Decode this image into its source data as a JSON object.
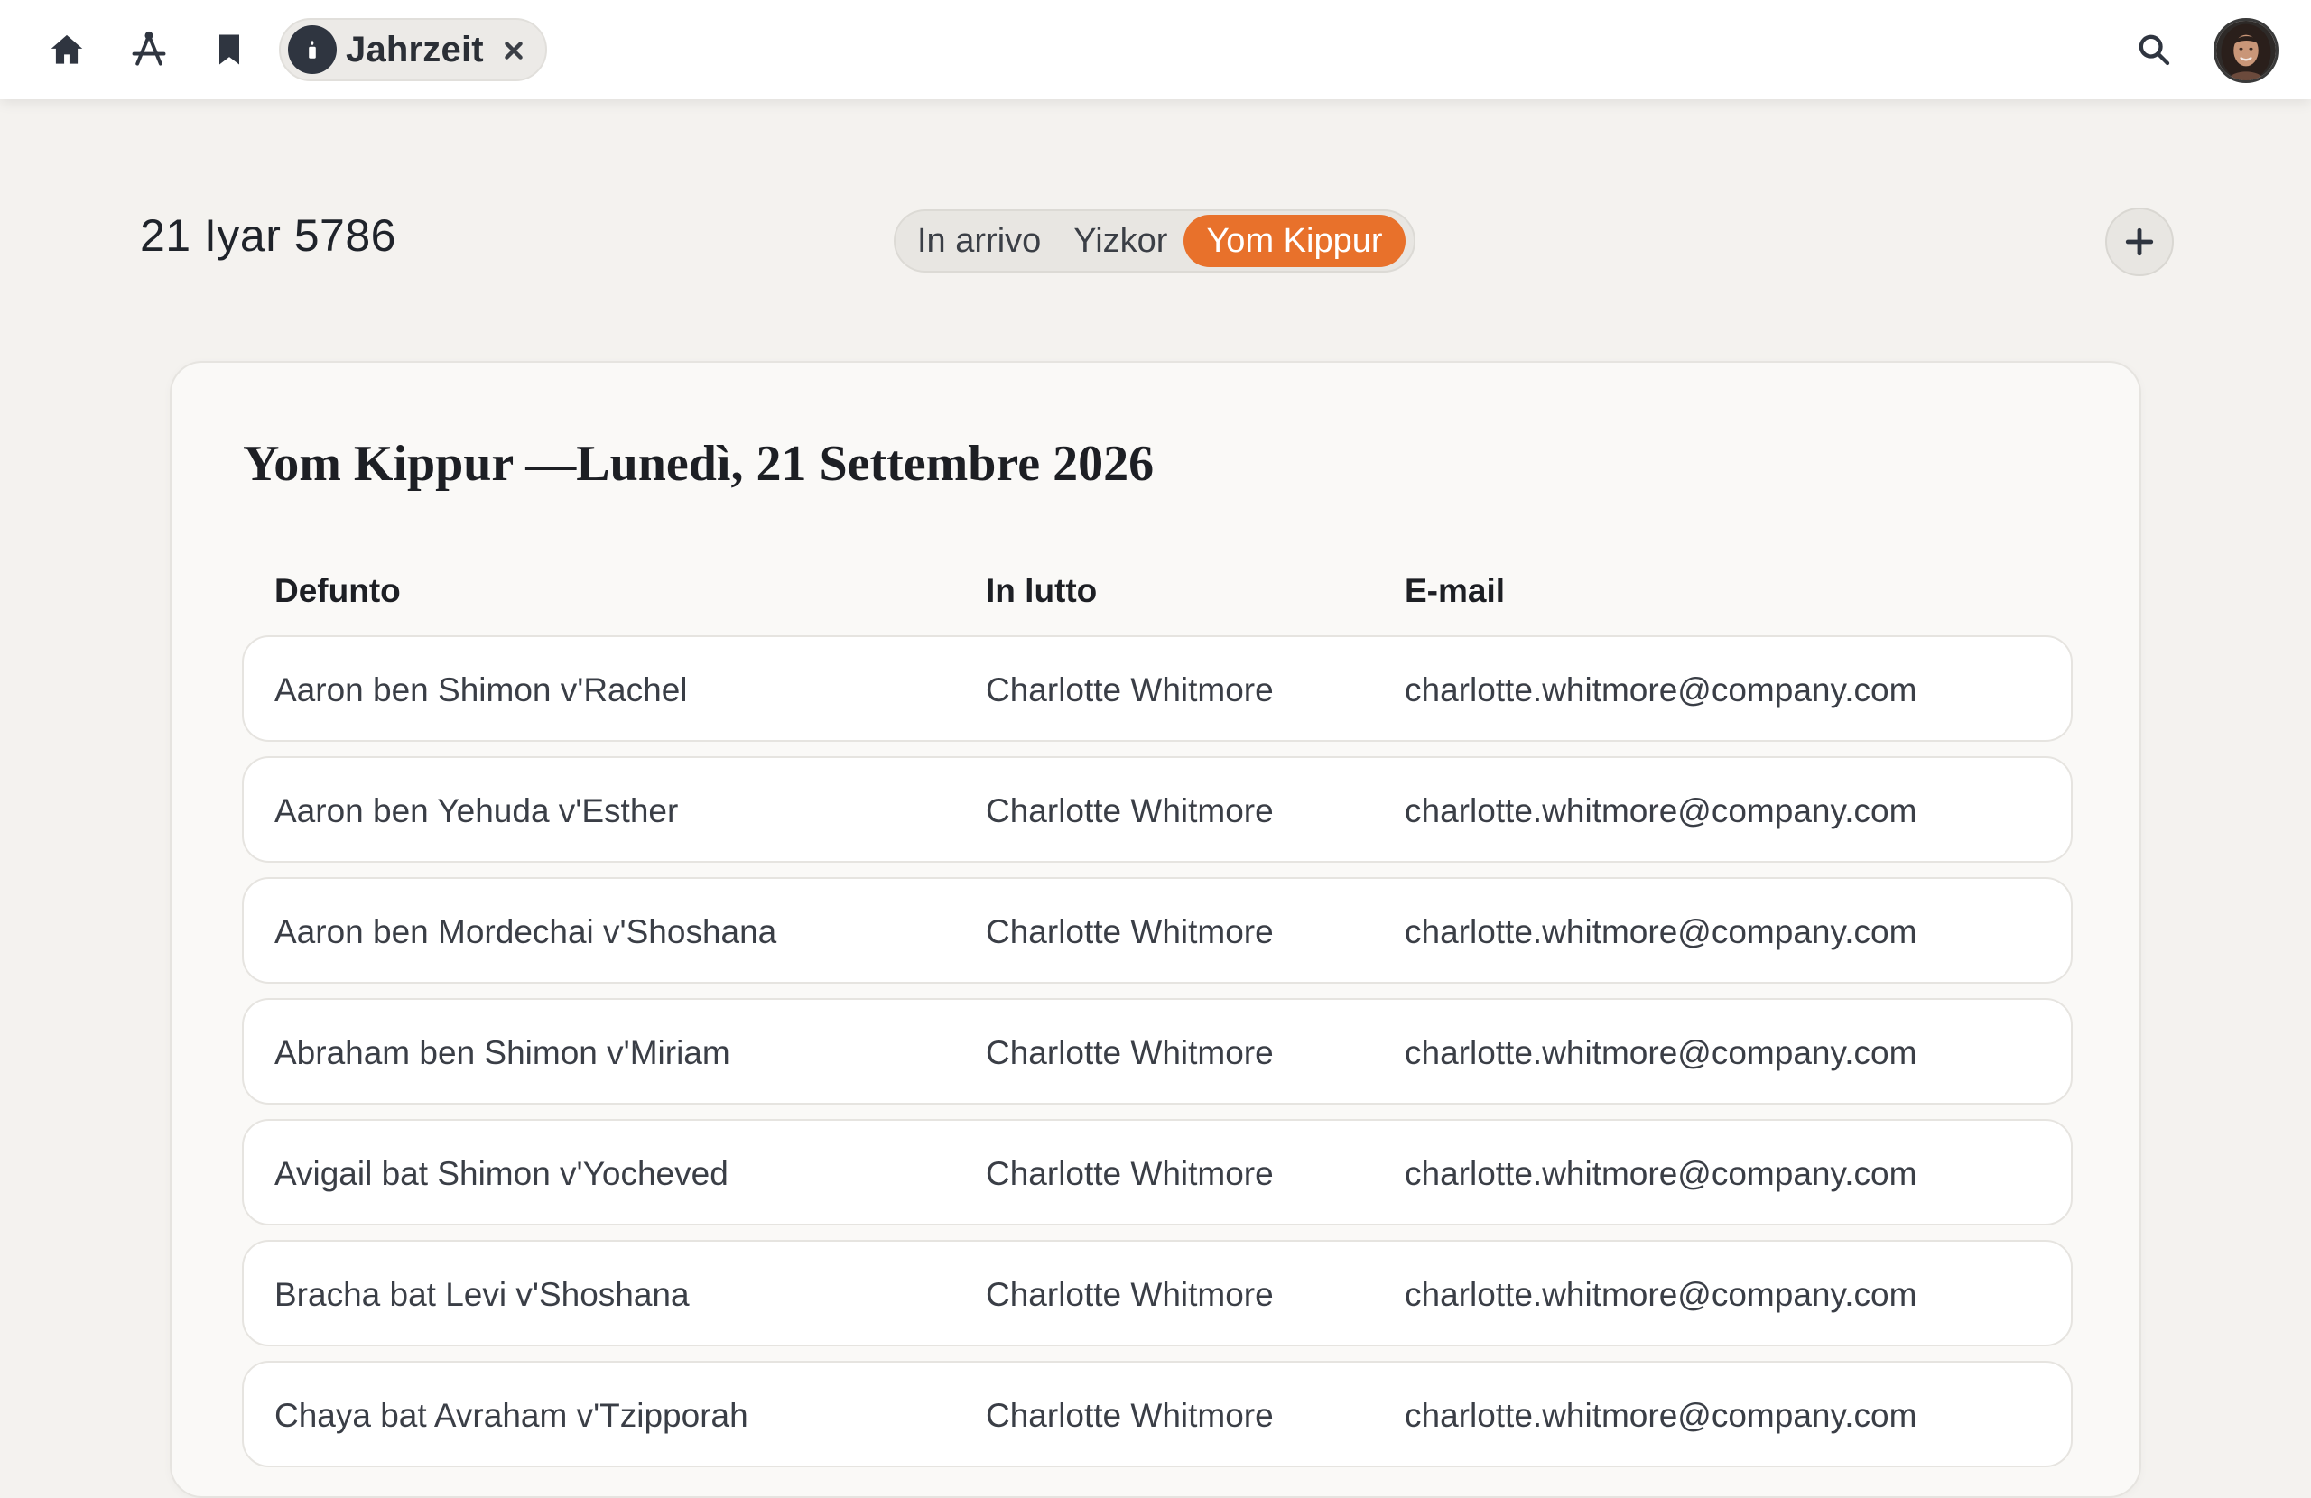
{
  "topbar": {
    "icons": [
      "home-icon",
      "compass-tool-icon",
      "bookmark-icon"
    ],
    "app_pill": {
      "label": "Jahrzeit",
      "badge_icon": "candle-icon",
      "close_icon": "close-icon"
    },
    "search_icon": "search-icon",
    "avatar": "user-avatar"
  },
  "header": {
    "date": "21 Iyar 5786",
    "tabs": [
      "In arrivo",
      "Yizkor",
      "Yom Kippur"
    ],
    "active_tab": "Yom Kippur",
    "add_icon": "plus-icon"
  },
  "card": {
    "title": "Yom Kippur —Lunedì, 21 Settembre 2026",
    "columns": [
      "Defunto",
      "In lutto",
      "E-mail"
    ],
    "rows": [
      [
        "Aaron ben Shimon v'Rachel",
        "Charlotte Whitmore",
        "charlotte.whitmore@company.com"
      ],
      [
        "Aaron ben Yehuda v'Esther",
        "Charlotte Whitmore",
        "charlotte.whitmore@company.com"
      ],
      [
        "Aaron ben Mordechai v'Shoshana",
        "Charlotte Whitmore",
        "charlotte.whitmore@company.com"
      ],
      [
        "Abraham ben Shimon v'Miriam",
        "Charlotte Whitmore",
        "charlotte.whitmore@company.com"
      ],
      [
        "Avigail bat Shimon v'Yocheved",
        "Charlotte Whitmore",
        "charlotte.whitmore@company.com"
      ],
      [
        "Bracha bat Levi v'Shoshana",
        "Charlotte Whitmore",
        "charlotte.whitmore@company.com"
      ],
      [
        "Chaya bat Avraham v'Tzipporah",
        "Charlotte Whitmore",
        "charlotte.whitmore@company.com"
      ]
    ]
  },
  "colors": {
    "accent": "#e8712b",
    "background": "#f4f2ef",
    "card": "#faf9f7",
    "text": "#2b2f36"
  }
}
